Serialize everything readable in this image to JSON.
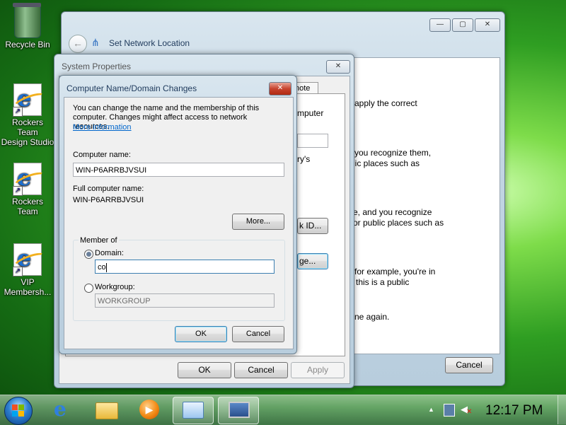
{
  "desktop": {
    "icons": [
      {
        "label": "Recycle Bin"
      },
      {
        "label": "Rockers Team\nDesign Studio"
      },
      {
        "label": "Rockers Team"
      },
      {
        "label": "VIP\nMembersh..."
      }
    ]
  },
  "back_window": {
    "title": "Set Network Location",
    "body_lines": [
      "apply the correct",
      "d you recognize them,",
      "lic places such as",
      "e, and you recognize",
      "or public places such as",
      "for example, you're in",
      "this is a public",
      "ne again."
    ],
    "cancel_label": "Cancel"
  },
  "system_properties": {
    "title": "System Properties",
    "tab_partial": "note",
    "partial_lines": [
      "mputer",
      "ry's"
    ],
    "network_id_partial": "k ID...",
    "change_partial": "ge...",
    "ok_label": "OK",
    "cancel_label": "Cancel",
    "apply_label": "Apply"
  },
  "dialog": {
    "title": "Computer Name/Domain Changes",
    "intro": "You can change the name and the membership of this computer. Changes might affect access to network resources.",
    "more_info_link": "More information",
    "computer_name_label": "Computer name:",
    "computer_name_value": "WIN-P6ARRBJVSUI",
    "full_name_label": "Full computer name:",
    "full_name_value": "WIN-P6ARRBJVSUI",
    "more_button": "More...",
    "member_of_label": "Member of",
    "domain_label": "Domain:",
    "domain_value": "co",
    "workgroup_label": "Workgroup:",
    "workgroup_value": "WORKGROUP",
    "ok_label": "OK",
    "cancel_label": "Cancel",
    "close_glyph": "x"
  },
  "taskbar": {
    "clock": "12:17 PM",
    "tray_up_arrow": "▲"
  }
}
